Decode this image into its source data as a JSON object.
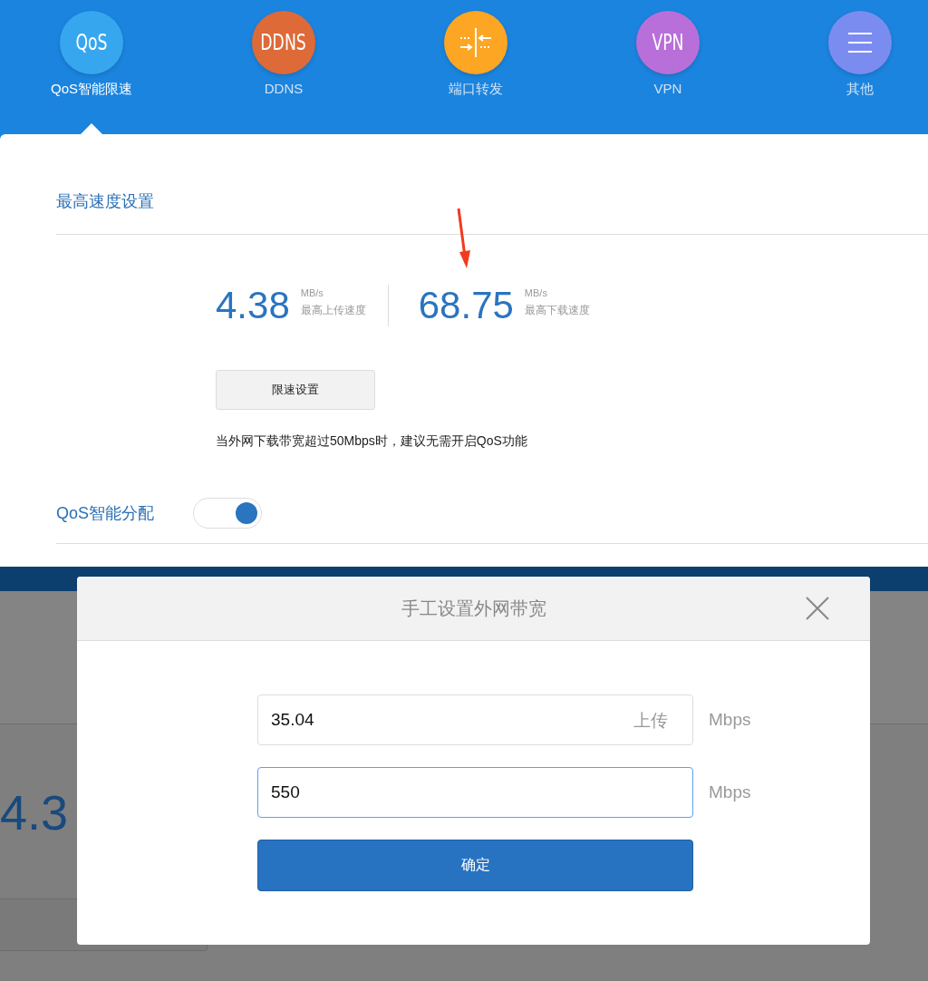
{
  "nav": [
    {
      "label": "QoS智能限速",
      "kind": "text",
      "badge": "QoS",
      "color": "#36a7ef",
      "selected": true
    },
    {
      "label": "DDNS",
      "kind": "text",
      "badge": "DDNS",
      "color": "#de6a38",
      "selected": false
    },
    {
      "label": "端口转发",
      "kind": "ports",
      "color": "#fca623",
      "selected": false
    },
    {
      "label": "VPN",
      "kind": "text",
      "badge": "VPN",
      "color": "#b86fd9",
      "selected": false
    },
    {
      "label": "其他",
      "kind": "menu",
      "color": "#7b8cf1",
      "selected": false
    }
  ],
  "speed_section": {
    "title": "最高速度设置",
    "stats": [
      {
        "value": "4.38",
        "unit": "MB/s",
        "caption": "最高上传速度"
      },
      {
        "value": "68.75",
        "unit": "MB/s",
        "caption": "最高下载速度"
      }
    ],
    "button": "限速设置",
    "hint": "当外网下载带宽超过50Mbps时，建议无需开启QoS功能"
  },
  "qos": {
    "label": "QoS智能分配",
    "on": true
  },
  "background_page": {
    "speed_value": "4.3"
  },
  "dialog": {
    "title": "手工设置外网带宽",
    "fields": [
      {
        "value": "35.04",
        "suffix": "上传",
        "unit": "Mbps",
        "focused": false
      },
      {
        "value": "550",
        "unit": "Mbps",
        "focused": true
      }
    ],
    "confirm": "确定"
  }
}
